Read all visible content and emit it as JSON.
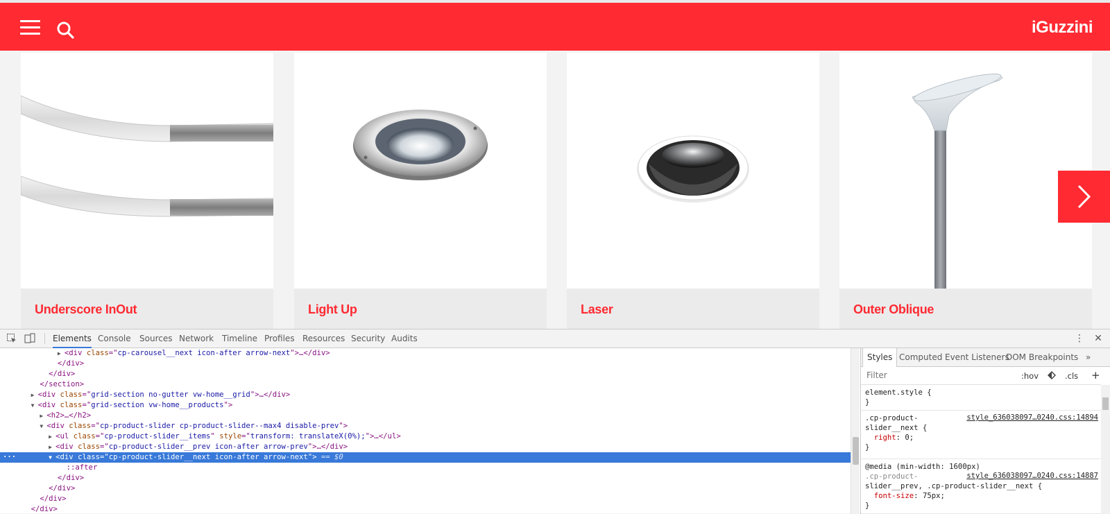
{
  "site": {
    "logo": "iGuzzini",
    "products": [
      {
        "name": "Underscore InOut"
      },
      {
        "name": "Light Up"
      },
      {
        "name": "Laser"
      },
      {
        "name": "Outer Oblique"
      }
    ],
    "colors": {
      "brand": "#ff2a32",
      "caption_bg": "#ebebeb"
    }
  },
  "devtools": {
    "tabs": [
      "Elements",
      "Console",
      "Sources",
      "Network",
      "Timeline",
      "Profiles",
      "Resources",
      "Security",
      "Audits"
    ],
    "active_tab": "Elements",
    "dom": {
      "l0": {
        "open": "<div ",
        "attr": "class",
        "eq": "=\"",
        "val": "cp-carousel__next icon-after arrow-next",
        "close": "\">…</div>"
      },
      "l1": "</div>",
      "l2": "</div>",
      "l3": "</section>",
      "l4": {
        "open": "<div ",
        "attr": "class",
        "eq": "=\"",
        "val": "grid-section no-gutter vw-home__grid",
        "close": "\">…</div>"
      },
      "l5": {
        "open": "<div ",
        "attr": "class",
        "eq": "=\"",
        "val": "grid-section vw-home__products",
        "close": "\">"
      },
      "l6": "<h2>…</h2>",
      "l7": {
        "open": "<div ",
        "attr": "class",
        "eq": "=\"",
        "val": "cp-product-slider cp-product-slider--max4 disable-prev",
        "close": "\">"
      },
      "l8": {
        "open": "<ul ",
        "attr": "class",
        "eq": "=\"",
        "val": "cp-product-slider__items",
        "mid": "\" ",
        "attr2": "style",
        "eq2": "=\"",
        "val2": "transform: translateX(0%);",
        "close": "\">…</ul>"
      },
      "l9": {
        "open": "<div ",
        "attr": "class",
        "eq": "=\"",
        "val": "cp-product-slider__prev icon-after arrow-prev",
        "close": "\">…</div>"
      },
      "l10": {
        "open": "<div ",
        "attr": "class",
        "eq": "=\"",
        "val": "cp-product-slider__next icon-after arrow-next",
        "close": "\">",
        "suffix": " == $0"
      },
      "l11": "::after",
      "l12": "</div>",
      "l13": "</div>",
      "l14": "</div>",
      "l15": "</div>"
    },
    "styles": {
      "tabs": [
        "Styles",
        "Computed",
        "Event Listeners",
        "DOM Breakpoints"
      ],
      "more": "»",
      "filter_placeholder": "Filter",
      "hov": ":hov",
      "cls": ".cls",
      "add": "+",
      "r1": {
        "sel": "element.style {",
        "end": "}"
      },
      "r2": {
        "sel1": ".cp-product-",
        "sel2": "slider__next {",
        "src": "style_636038097…0240.css:14894",
        "prop": "right",
        "val": "0;",
        "end": "}"
      },
      "r3": {
        "media": "@media (min-width: 1600px)",
        "sel1": ".cp-product-",
        "sel2": "slider__prev, .cp-product-slider__next {",
        "src": "style_636038097…0240.css:14887",
        "prop": "font-size",
        "val": "75px;",
        "end": "}"
      }
    }
  }
}
